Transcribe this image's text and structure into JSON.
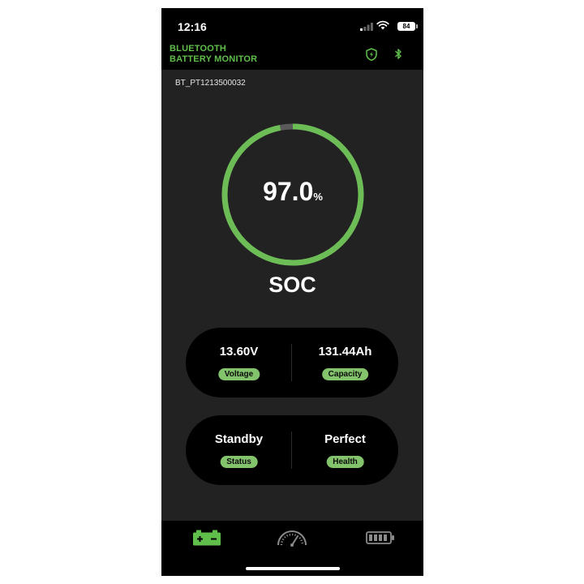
{
  "status_bar": {
    "time": "12:16",
    "battery": "84"
  },
  "header": {
    "title_line1": "BLUETOOTH",
    "title_line2": "BATTERY MONITOR"
  },
  "device": {
    "name": "BT_PT1213500032"
  },
  "soc": {
    "value": "97.0",
    "unit": "%",
    "label": "SOC",
    "fraction": 0.97
  },
  "metrics": {
    "voltage": {
      "value": "13.60V",
      "label": "Voltage"
    },
    "capacity": {
      "value": "131.44Ah",
      "label": "Capacity"
    },
    "status": {
      "value": "Standby",
      "label": "Status"
    },
    "health": {
      "value": "Perfect",
      "label": "Health"
    }
  },
  "colors": {
    "accent": "#5fbf4a",
    "ring": "#6dbd57",
    "pill": "#82c36b",
    "inactive": "#8a8a8a"
  },
  "icons": {
    "header": [
      "shield-lightning-icon",
      "bluetooth-icon"
    ],
    "nav": [
      "car-battery-icon",
      "gauge-icon",
      "battery-level-icon"
    ]
  }
}
